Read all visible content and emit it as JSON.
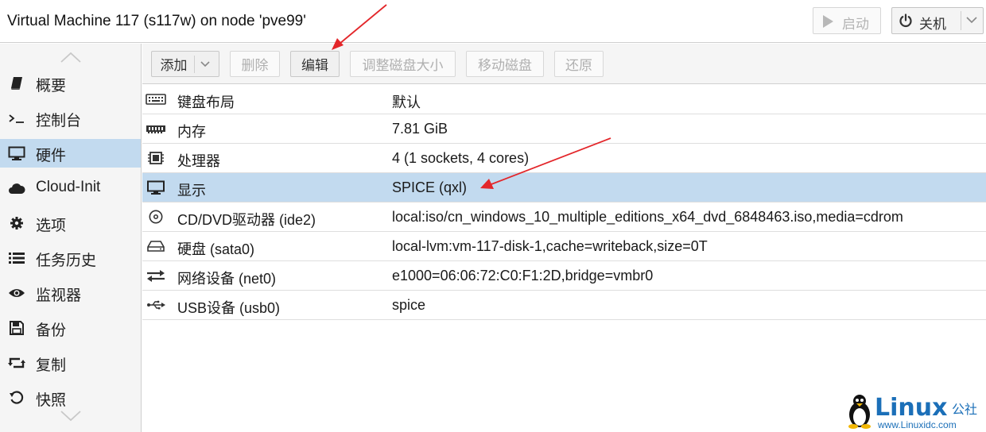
{
  "titlebar": {
    "title": "Virtual Machine 117 (s117w) on node 'pve99'",
    "start_label": "启动",
    "shutdown_label": "关机"
  },
  "sidebar": {
    "items": [
      {
        "label": "概要",
        "icon": "book-icon"
      },
      {
        "label": "控制台",
        "icon": "terminal-icon"
      },
      {
        "label": "硬件",
        "icon": "monitor-icon",
        "active": true
      },
      {
        "label": "Cloud-Init",
        "icon": "cloud-icon"
      },
      {
        "label": "选项",
        "icon": "gear-icon"
      },
      {
        "label": "任务历史",
        "icon": "list-icon"
      },
      {
        "label": "监视器",
        "icon": "eye-icon"
      },
      {
        "label": "备份",
        "icon": "floppy-icon"
      },
      {
        "label": "复制",
        "icon": "retweet-icon"
      },
      {
        "label": "快照",
        "icon": "history-icon"
      }
    ]
  },
  "toolbar": {
    "add_label": "添加",
    "remove_label": "删除",
    "edit_label": "编辑",
    "resize_label": "调整磁盘大小",
    "move_label": "移动磁盘",
    "revert_label": "还原"
  },
  "hardware": {
    "rows": [
      {
        "name": "键盘布局",
        "value": "默认",
        "icon": "keyboard-icon"
      },
      {
        "name": "内存",
        "value": "7.81 GiB",
        "icon": "memory-icon"
      },
      {
        "name": "处理器",
        "value": "4 (1 sockets, 4 cores)",
        "icon": "cpu-icon"
      },
      {
        "name": "显示",
        "value": "SPICE (qxl)",
        "icon": "desktop-icon",
        "selected": true
      },
      {
        "name": "CD/DVD驱动器 (ide2)",
        "value": "local:iso/cn_windows_10_multiple_editions_x64_dvd_6848463.iso,media=cdrom",
        "icon": "cdrom-icon"
      },
      {
        "name": "硬盘 (sata0)",
        "value": "local-lvm:vm-117-disk-1,cache=writeback,size=0T",
        "icon": "hdd-icon"
      },
      {
        "name": "网络设备 (net0)",
        "value": "e1000=06:06:72:C0:F1:2D,bridge=vmbr0",
        "icon": "exchange-icon"
      },
      {
        "name": "USB设备 (usb0)",
        "value": "spice",
        "icon": "usb-icon"
      }
    ]
  },
  "colors": {
    "selection": "#c2daef",
    "arrow": "#e3262a",
    "watermark": "#1b6fb8"
  },
  "watermark": {
    "brand": "Linux",
    "cn": "公社",
    "url": "www.Linuxidc.com"
  }
}
